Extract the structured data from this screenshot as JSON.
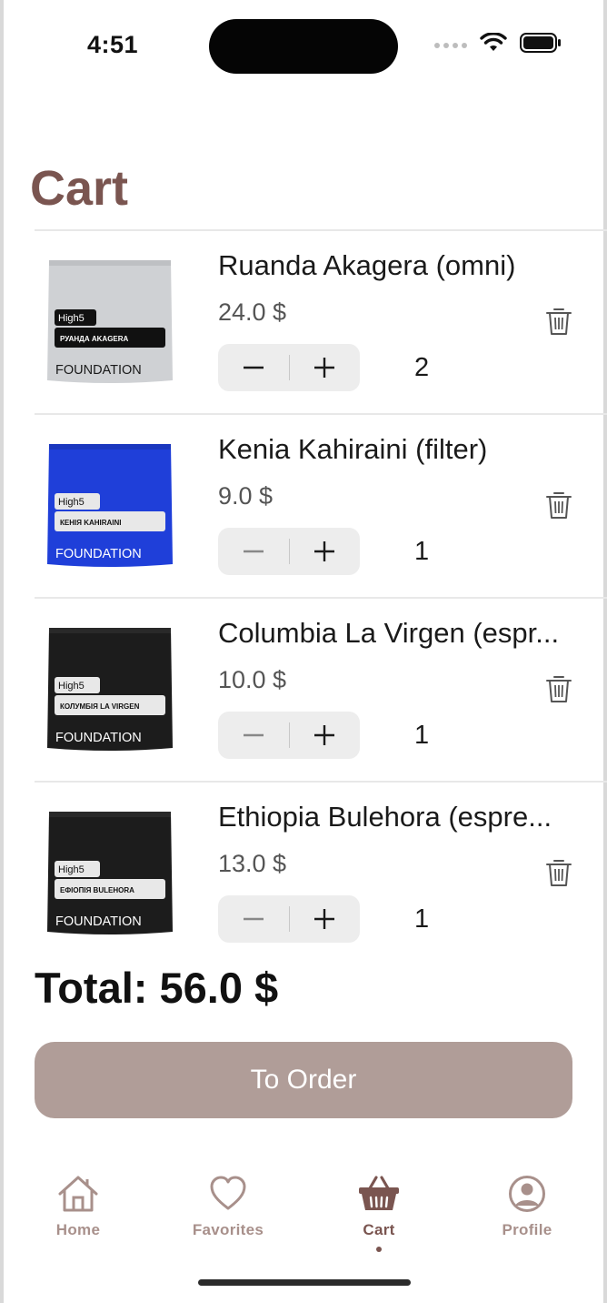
{
  "status_bar": {
    "time": "4:51"
  },
  "page": {
    "title": "Cart"
  },
  "cart": {
    "items": [
      {
        "name": "Ruanda Akagera (omni)",
        "price": "24.0 $",
        "quantity": "2",
        "bag_color": "#cfd1d4",
        "bag_label": "РУАНДА AKAGERA",
        "brand": "FOUNDATION",
        "logo": "High5"
      },
      {
        "name": "Kenia Kahiraini (filter)",
        "price": "9.0 $",
        "quantity": "1",
        "bag_color": "#1f3fd9",
        "bag_label": "КЕНІЯ KAHIRAINI",
        "brand": "FOUNDATION",
        "logo": "High5"
      },
      {
        "name": "Columbia La Virgen (espr...",
        "price": "10.0 $",
        "quantity": "1",
        "bag_color": "#1c1c1c",
        "bag_label": "КОЛУМБІЯ LA VIRGEN",
        "brand": "FOUNDATION",
        "logo": "High5"
      },
      {
        "name": "Ethiopia Bulehora (espre...",
        "price": "13.0 $",
        "quantity": "1",
        "bag_color": "#1c1c1c",
        "bag_label": "ЕФІОПІЯ BULEHORA",
        "brand": "FOUNDATION",
        "logo": "High5"
      }
    ],
    "total": "Total: 56.0 $",
    "order_button": "To Order"
  },
  "tabbar": {
    "items": [
      {
        "label": "Home",
        "icon": "house-icon"
      },
      {
        "label": "Favorites",
        "icon": "heart-icon"
      },
      {
        "label": "Cart",
        "icon": "basket-icon",
        "active": true
      },
      {
        "label": "Profile",
        "icon": "user-circle-icon"
      }
    ]
  },
  "colors": {
    "accent": "#7a5550",
    "button": "#b09d98",
    "inactive_tab": "#a8908b"
  }
}
